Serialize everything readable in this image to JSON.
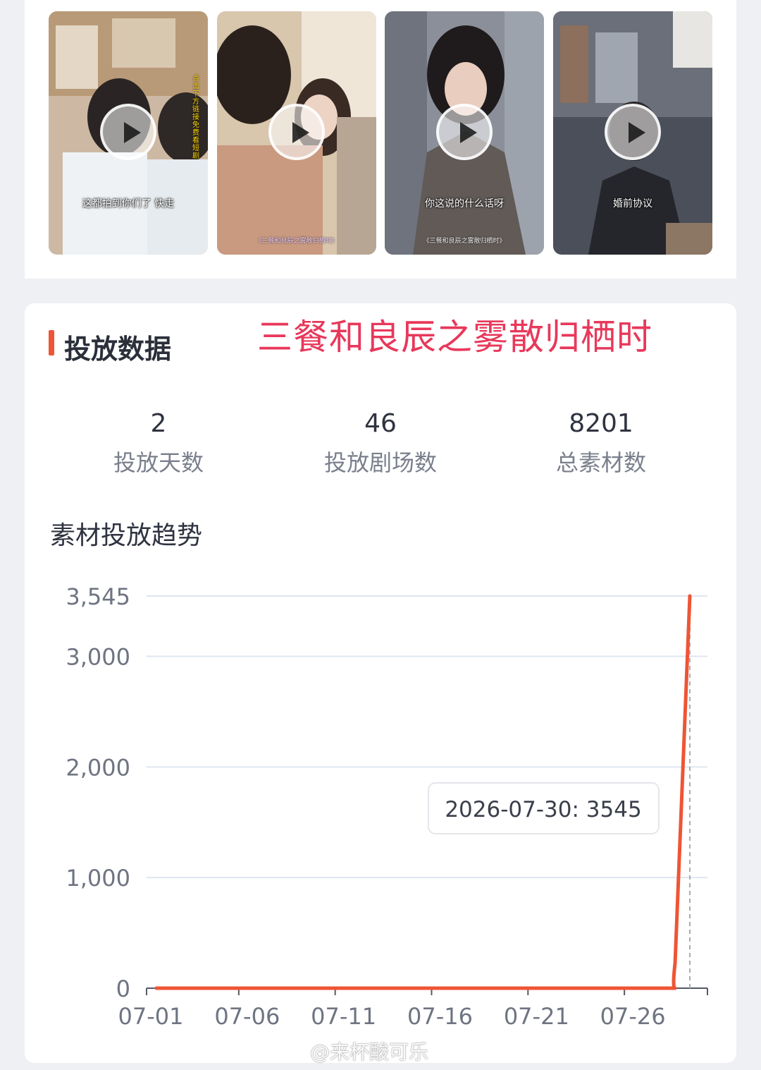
{
  "thumbnails": [
    {
      "caption": "这都拍到你们了 快走",
      "side_caption": "点击下方链接 免费看短剧",
      "sub_caption": "",
      "scene": "doctors"
    },
    {
      "caption": "",
      "side_caption": "",
      "sub_caption": "《三餐和良辰之雾散归栖时》",
      "scene": "couple"
    },
    {
      "caption": "你这说的什么话呀",
      "side_caption": "",
      "sub_caption": "《三餐和良辰之雾散归栖时》",
      "scene": "woman-suit"
    },
    {
      "caption": "婚前协议",
      "side_caption": "",
      "sub_caption": "",
      "scene": "man-office"
    }
  ],
  "section": {
    "title": "投放数据",
    "overlay_title": "三餐和良辰之雾散归栖时"
  },
  "stats": [
    {
      "value": "2",
      "label": "投放天数"
    },
    {
      "value": "46",
      "label": "投放剧场数"
    },
    {
      "value": "8201",
      "label": "总素材数"
    }
  ],
  "trend_title": "素材投放趋势",
  "tooltip": "2026-07-30: 3545",
  "watermark": "@来杯酸可乐",
  "colors": {
    "line": "#ee5535",
    "accent": "#ee5535",
    "overlay": "#e8385b"
  },
  "chart_data": {
    "type": "line",
    "x_ticks": [
      "07-01",
      "07-06",
      "07-11",
      "07-16",
      "07-21",
      "07-26"
    ],
    "y_ticks": [
      0,
      1000,
      2000,
      3000,
      3545
    ],
    "y_tick_labels": [
      "0",
      "1,000",
      "2,000",
      "3,000",
      "3,545"
    ],
    "ylim": [
      0,
      3545
    ],
    "x": [
      "07-01",
      "07-02",
      "07-03",
      "07-04",
      "07-05",
      "07-06",
      "07-07",
      "07-08",
      "07-09",
      "07-10",
      "07-11",
      "07-12",
      "07-13",
      "07-14",
      "07-15",
      "07-16",
      "07-17",
      "07-18",
      "07-19",
      "07-20",
      "07-21",
      "07-22",
      "07-23",
      "07-24",
      "07-25",
      "07-26",
      "07-27",
      "07-28",
      "07-29",
      "07-30"
    ],
    "series": [
      {
        "values": [
          0,
          0,
          0,
          0,
          0,
          0,
          0,
          0,
          0,
          0,
          0,
          0,
          0,
          0,
          0,
          0,
          0,
          0,
          0,
          0,
          0,
          0,
          0,
          0,
          0,
          0,
          0,
          0,
          1500,
          3545
        ]
      }
    ],
    "highlight": {
      "x": "07-30",
      "y": 3545
    },
    "grid": true
  }
}
